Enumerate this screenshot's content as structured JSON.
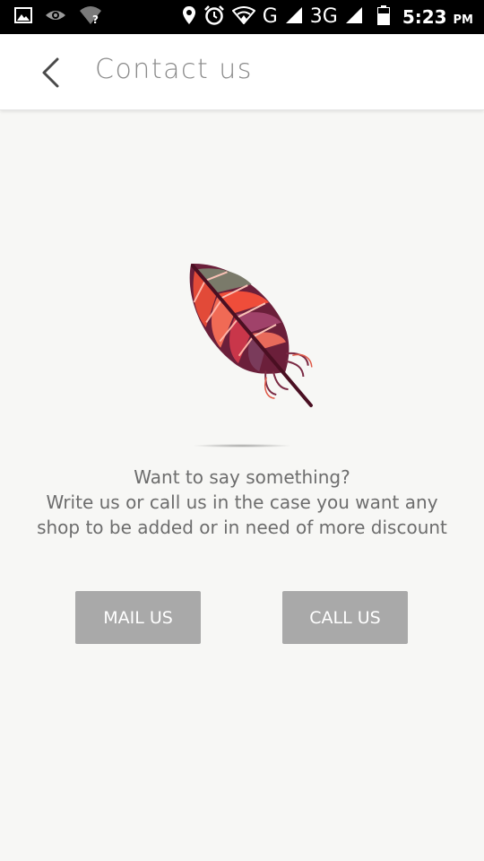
{
  "status_bar": {
    "network": [
      "G",
      "3G"
    ],
    "time": "5:23",
    "time_suffix": "PM",
    "icons": [
      "gallery-icon",
      "eye-icon",
      "wifi-question-icon",
      "location-icon",
      "alarm-icon",
      "hotspot-icon",
      "signal-icon",
      "battery-icon"
    ]
  },
  "app_bar": {
    "title": "Contact us",
    "back_icon": "chevron-left-icon"
  },
  "content": {
    "illustration": "feather-icon",
    "line1": "Want to say something?",
    "line2": "Write us or call us in the case you want any",
    "line3": "shop to be added or in need of more discount"
  },
  "buttons": {
    "mail_label": "MAIL US",
    "call_label": "CALL US"
  },
  "colors": {
    "background": "#f7f7f5",
    "button": "#a9a9a9",
    "title": "#8a8a8a",
    "text": "#6d6d6d"
  }
}
